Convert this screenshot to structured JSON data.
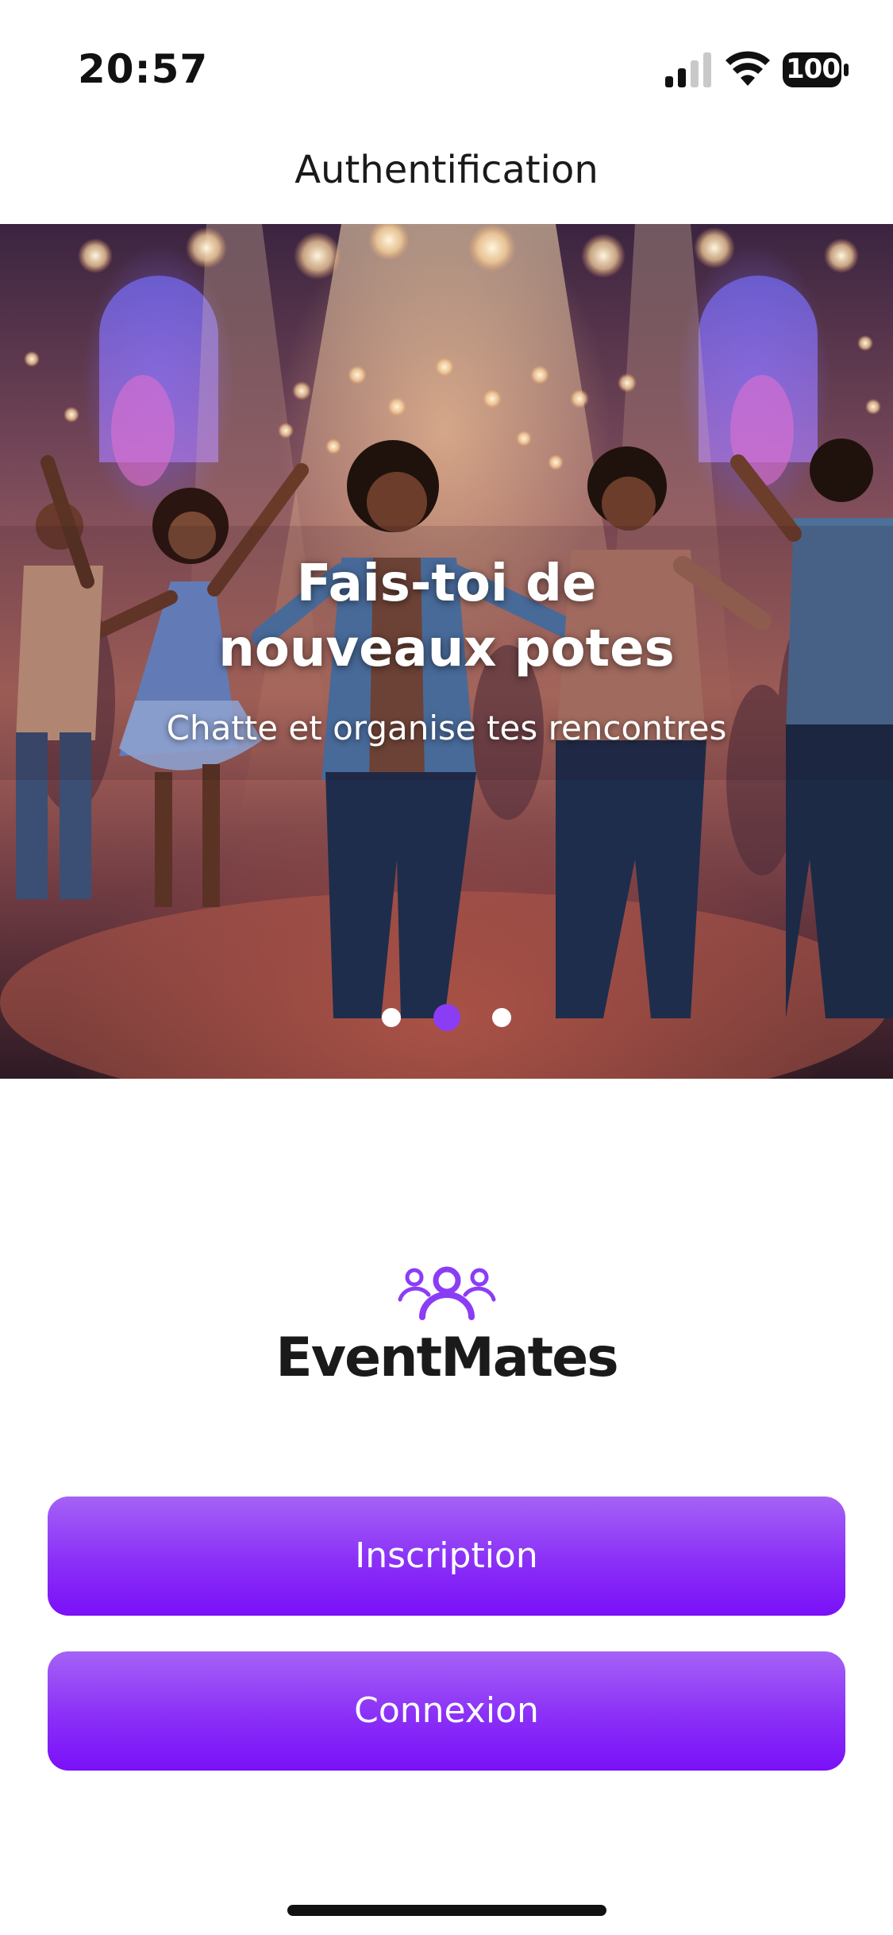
{
  "status_bar": {
    "time": "20:57",
    "battery": "100",
    "icons": [
      "signal-icon",
      "wifi-icon",
      "battery-icon"
    ]
  },
  "nav": {
    "title": "Authentification"
  },
  "hero": {
    "title_line1": "Fais-toi de",
    "title_line2": "nouveaux potes",
    "subtitle": "Chatte et organise tes rencontres",
    "image": "dancing-party-crowd-photo",
    "pager": {
      "count": 3,
      "active_index": 1
    }
  },
  "brand": {
    "name": "EventMates",
    "icon": "group-people-icon"
  },
  "buttons": {
    "signup": "Inscription",
    "login": "Connexion"
  },
  "colors": {
    "accent": "#8b3df5",
    "button_top": "#a562f5",
    "button_bottom": "#7a10f8",
    "text": "#1a1a1a"
  }
}
